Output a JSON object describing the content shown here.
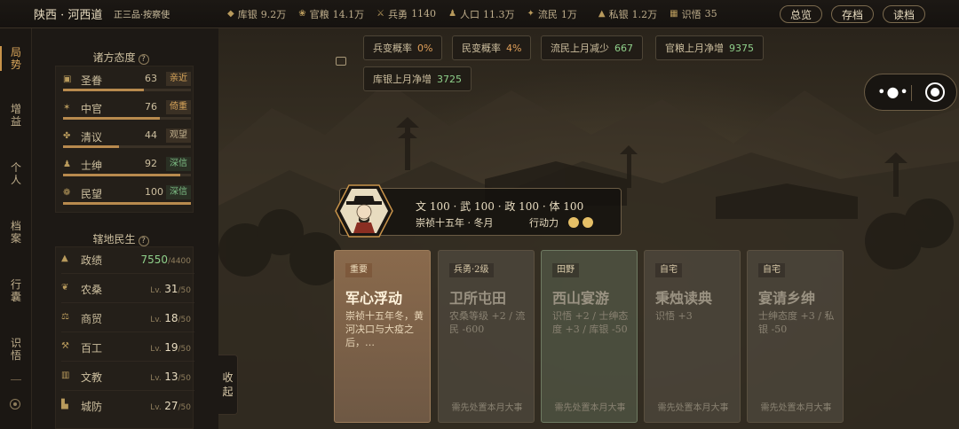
{
  "topbar": {
    "region": "陕西 · 河西道",
    "rank": "正三品·按察使",
    "stats": [
      {
        "icon": "coins-icon",
        "label": "库银",
        "value": "9.2万"
      },
      {
        "icon": "grain-icon",
        "label": "官粮",
        "value": "14.1万"
      },
      {
        "icon": "soldier-icon",
        "label": "兵勇",
        "value": "1140"
      },
      {
        "icon": "population-icon",
        "label": "人口",
        "value": "11.3万"
      },
      {
        "icon": "refugee-icon",
        "label": "流民",
        "value": "1万"
      },
      {
        "icon": "silver-icon",
        "label": "私银",
        "value": "1.2万"
      },
      {
        "icon": "book-icon",
        "label": "识悟",
        "value": "35"
      }
    ],
    "buttons": {
      "overview": "总览",
      "save": "存档",
      "load": "读档"
    }
  },
  "leftnav": {
    "items": [
      {
        "label": "局势",
        "active": true
      },
      {
        "label": "增益",
        "active": false
      },
      {
        "label": "个人",
        "active": false
      },
      {
        "label": "档案",
        "active": false
      },
      {
        "label": "行囊",
        "active": false
      },
      {
        "label": "识悟",
        "active": false
      }
    ]
  },
  "attitudes": {
    "title": "诸方态度",
    "help": "?",
    "items": [
      {
        "name": "圣眷",
        "value": "63",
        "tag": "亲近",
        "pct": 63,
        "tone": "orange"
      },
      {
        "name": "中官",
        "value": "76",
        "tag": "倚重",
        "pct": 76,
        "tone": "orange"
      },
      {
        "name": "清议",
        "value": "44",
        "tag": "观望",
        "pct": 44,
        "tone": "grey"
      },
      {
        "name": "士绅",
        "value": "92",
        "tag": "深信",
        "pct": 92,
        "tone": "green"
      },
      {
        "name": "民望",
        "value": "100",
        "tag": "深信",
        "pct": 100,
        "tone": "green"
      }
    ]
  },
  "livelihood": {
    "title": "辖地民生",
    "help": "?",
    "items": [
      {
        "name": "政绩",
        "value": "7550",
        "max": "/4400",
        "type": "score"
      },
      {
        "name": "农桑",
        "lv": "Lv.",
        "value": "31",
        "max": "/50"
      },
      {
        "name": "商贸",
        "lv": "Lv.",
        "value": "18",
        "max": "/50"
      },
      {
        "name": "百工",
        "lv": "Lv.",
        "value": "19",
        "max": "/50"
      },
      {
        "name": "文教",
        "lv": "Lv.",
        "value": "13",
        "max": "/50"
      },
      {
        "name": "城防",
        "lv": "Lv.",
        "value": "27",
        "max": "/50"
      }
    ]
  },
  "collapse": {
    "line1": "收",
    "line2": "起"
  },
  "chips": [
    {
      "label": "兵变概率",
      "value": "0%",
      "tone": "orange"
    },
    {
      "label": "民变概率",
      "value": "4%",
      "tone": "orange"
    },
    {
      "label": "流民上月减少",
      "value": "667",
      "tone": "green"
    },
    {
      "label": "官粮上月净增",
      "value": "9375",
      "tone": "green"
    },
    {
      "label": "库银上月净增",
      "value": "3725",
      "tone": "green"
    }
  ],
  "character": {
    "stats_line": "文 100 · 武 100 · 政 100 · 体 100",
    "date": "崇祯十五年 · 冬月",
    "action_label": "行动力",
    "action_points": 2
  },
  "cards": [
    {
      "tag": "重要",
      "title": "军心浮动",
      "desc": "崇祯十五年冬，黄河决口与大疫之后，…",
      "footer": "",
      "style": "primary"
    },
    {
      "tag": "兵勇·2级",
      "title": "卫所屯田",
      "desc": "农桑等级 +2 / 流民 -600",
      "footer": "需先处置本月大事",
      "style": "grey"
    },
    {
      "tag": "田野",
      "title": "西山宴游",
      "desc": "识悟 +2 / 士绅态度 +3 / 库银 -50",
      "footer": "需先处置本月大事",
      "style": "green"
    },
    {
      "tag": "自宅",
      "title": "秉烛读典",
      "desc": "识悟 +3",
      "footer": "需先处置本月大事",
      "style": "grey"
    },
    {
      "tag": "自宅",
      "title": "宴请乡绅",
      "desc": "士绅态度 +3 / 私银 -50",
      "footer": "需先处置本月大事",
      "style": "grey"
    }
  ],
  "colors": {
    "accent": "#c8934a",
    "green": "#8fcf8a",
    "orange": "#e0a05a",
    "gold": "#e6c067"
  }
}
